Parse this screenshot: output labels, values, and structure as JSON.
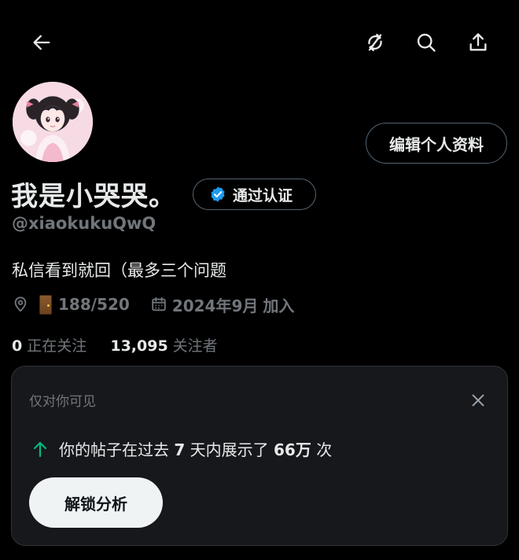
{
  "topbar": {
    "back_icon": "arrow-left-icon",
    "refresh_icon": "refresh-slash-icon",
    "search_icon": "search-icon",
    "share_icon": "share-upload-icon"
  },
  "profile": {
    "avatar_icon": "anime-girl-avatar",
    "edit_button": "编辑个人资料",
    "display_name": "我是小哭哭。",
    "verify_label": "通过认证",
    "verify_color": "#1d9bf0",
    "handle": "@xiaokukuQwQ",
    "bio": "私信看到就回（最多三个问题",
    "location_icon": "location-pin-icon",
    "door_emoji": "door",
    "location_text": "188/520",
    "calendar_icon": "calendar-icon",
    "joined_date": "2024年9月",
    "joined_suffix": "加入",
    "following_count": "0",
    "following_label": "正在关注",
    "followers_count": "13,095",
    "followers_label": "关注者"
  },
  "card": {
    "label": "仅对你可见",
    "close_icon": "close-icon",
    "arrow_icon": "arrow-up-icon",
    "arrow_color": "#00ba7c",
    "stat_prefix": "你的帖子在过去",
    "stat_days": "7",
    "stat_mid": "天内展示了",
    "stat_value": "66万",
    "stat_suffix": "次",
    "unlock_button": "解锁分析"
  }
}
